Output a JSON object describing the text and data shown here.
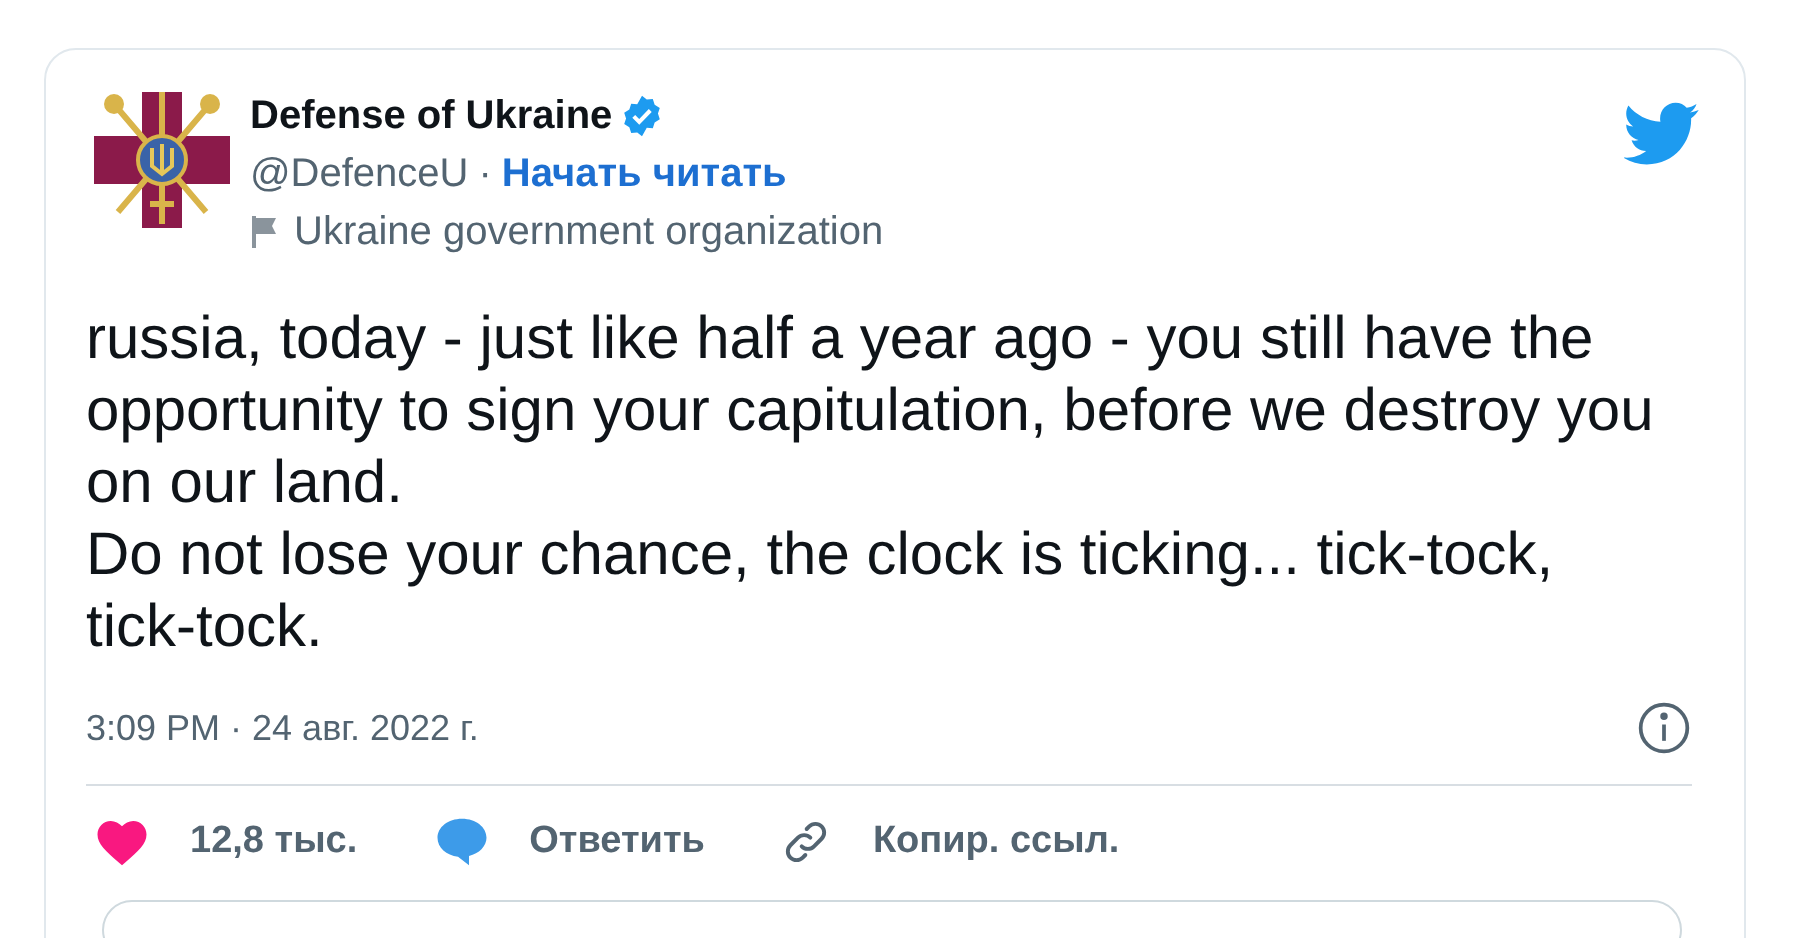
{
  "tweet": {
    "author": {
      "name": "Defense of Ukraine",
      "verified": true,
      "handle": "@DefenceU",
      "separator": "·",
      "follow_link": "Начать читать",
      "label": "Ukraine government organization"
    },
    "body": [
      "russia, today - just like half a year ago - you still have the opportunity to sign your capitulation, before we destroy you on our land.",
      "Do not lose your chance, the clock is ticking... tick-tock, tick-tock."
    ],
    "timestamp": "3:09 PM · 24 авг. 2022 г.",
    "actions": [
      {
        "kind": "like",
        "label": "12,8 тыс."
      },
      {
        "kind": "reply",
        "label": "Ответить"
      },
      {
        "kind": "copy_link",
        "label": "Копир. ссыл."
      }
    ]
  }
}
